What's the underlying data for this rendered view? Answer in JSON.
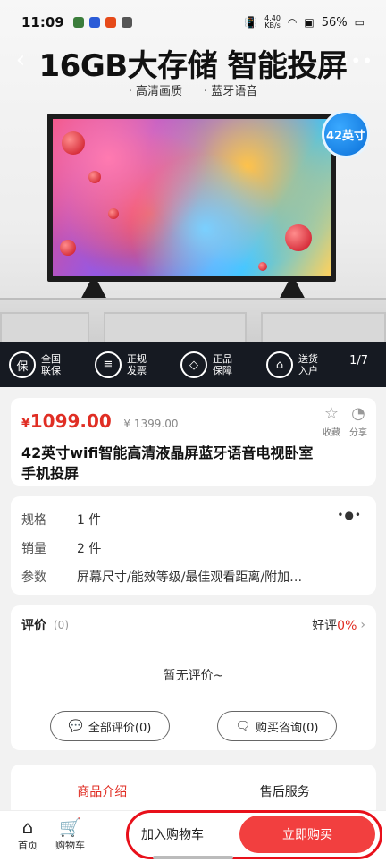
{
  "status_bar": {
    "time": "11:09",
    "speed_top": "4.40",
    "speed_unit": "KB/s",
    "battery": "56%"
  },
  "hero": {
    "headline": "16GB大存储 智能投屏",
    "features": [
      "· 高清画质",
      "· 蓝牙语音"
    ],
    "size_badge": "42英寸",
    "page_indicator": "1/7",
    "services": [
      {
        "icon": "guarantee-icon",
        "label": "全国\n联保"
      },
      {
        "icon": "invoice-icon",
        "label": "正规\n发票"
      },
      {
        "icon": "diamond-icon",
        "label": "正品\n保障"
      },
      {
        "icon": "home-delivery-icon",
        "label": "送货\n入户"
      }
    ]
  },
  "product": {
    "currency": "¥",
    "price": "1099.00",
    "original_price": "¥ 1399.00",
    "title": "42英寸wifi智能高清液晶屏蓝牙语音电视卧室手机投屏",
    "favorite_label": "收藏",
    "share_label": "分享"
  },
  "specs": [
    {
      "key": "规格",
      "value": "1 件"
    },
    {
      "key": "销量",
      "value": "2 件"
    },
    {
      "key": "参数",
      "value": "屏幕尺寸/能效等级/最佳观看距离/附加…"
    }
  ],
  "reviews": {
    "label": "评价",
    "count": "(0)",
    "good_label": "好评",
    "good_pct": "0%",
    "empty_text": "暂无评价~",
    "all_button": "全部评价(0)",
    "consult_button": "购买咨询(0)"
  },
  "tabs": [
    "商品介绍",
    "售后服务"
  ],
  "bottom_bar": {
    "home_label": "首页",
    "cart_label": "购物车",
    "add_to_cart": "加入购物车",
    "buy_now": "立即购买"
  },
  "colors": {
    "accent": "#e02e24",
    "buy_button": "#f23f3f",
    "highlight_ring": "#e8101a"
  }
}
